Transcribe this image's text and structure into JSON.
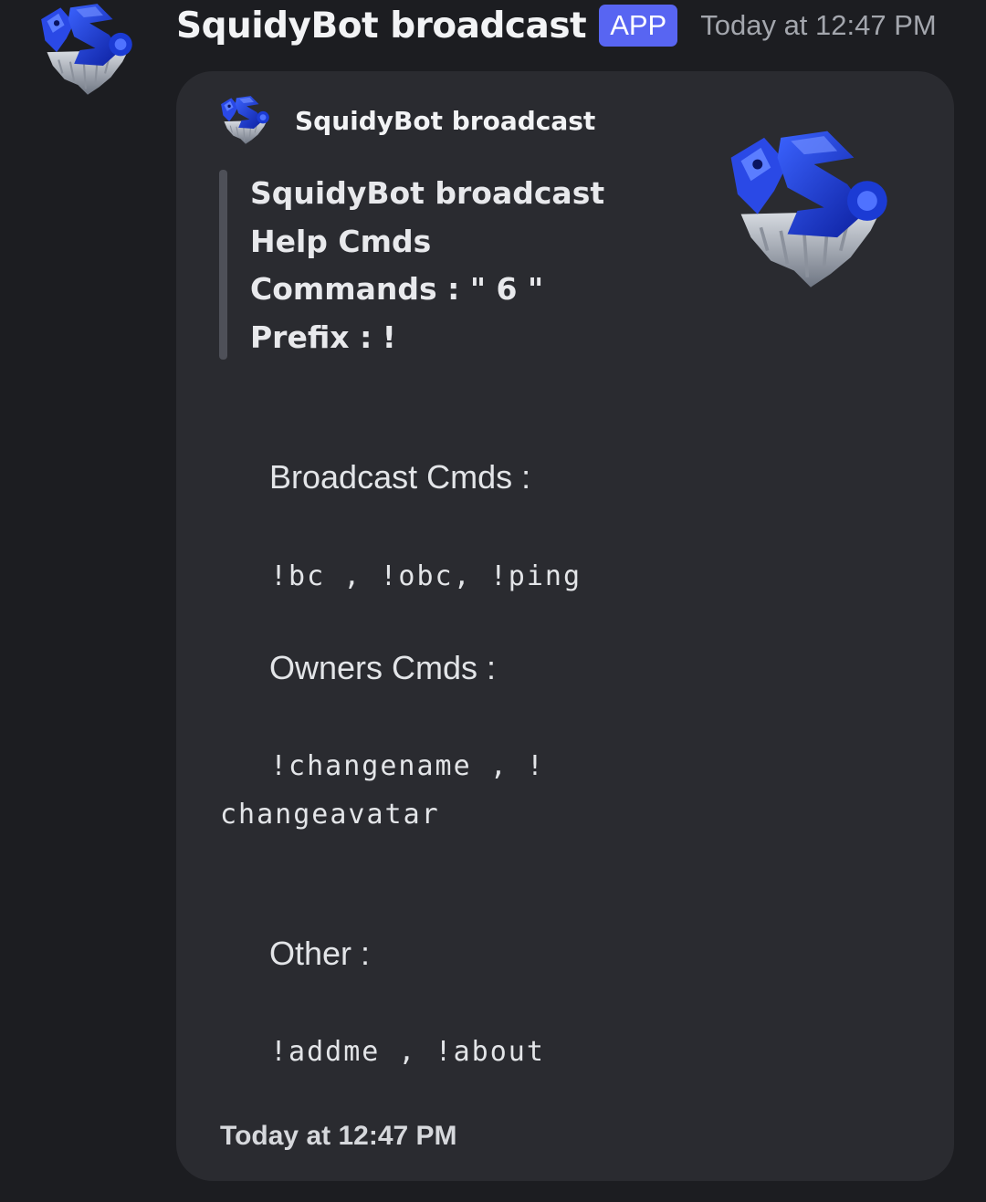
{
  "message": {
    "author_name": "SquidyBot broadcast",
    "badge": "APP",
    "timestamp": "Today at 12:47 PM",
    "avatar_icon": "squidybot-avatar-icon"
  },
  "embed": {
    "author_name": "SquidyBot broadcast",
    "author_icon": "squidybot-avatar-icon",
    "thumbnail_icon": "squidybot-avatar-icon",
    "quote_lines": [
      "SquidyBot broadcast",
      "Help Cmds",
      "Commands : \" 6 \"",
      "Prefix : !"
    ],
    "sections": [
      {
        "heading": "Broadcast Cmds :",
        "commands": [
          "!bc , !obc, !ping"
        ]
      },
      {
        "heading": "Owners Cmds :",
        "commands": [
          "!changename , !",
          "changeavatar"
        ]
      },
      {
        "heading": "Other :",
        "commands": [
          "!addme , !about"
        ]
      }
    ],
    "footer_timestamp": "Today at 12:47 PM"
  },
  "colors": {
    "background": "#1c1d21",
    "embed_background": "#2a2b30",
    "badge": "#5865f2",
    "quote_bar": "#4e5058",
    "avatar_blue": "#1f3fd6"
  }
}
